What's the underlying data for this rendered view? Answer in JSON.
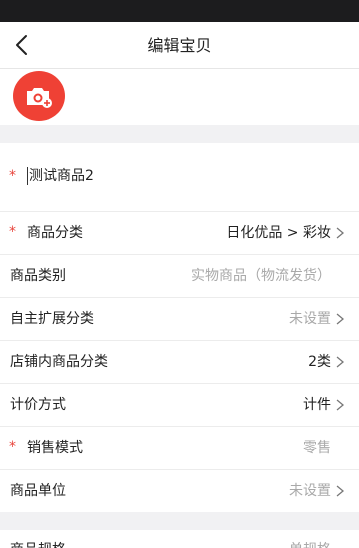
{
  "nav": {
    "title": "编辑宝贝",
    "back_icon": "chevron-left-icon"
  },
  "photo": {
    "add_icon": "camera-add-icon",
    "accent": "#ef4135"
  },
  "name_field": {
    "required_mark": "*",
    "value": "测试商品2"
  },
  "rows": [
    {
      "required": true,
      "label": "商品分类",
      "value": "日化优品 > 彩妆",
      "value_style": "dark",
      "chevron": true
    },
    {
      "required": false,
      "label": "商品类别",
      "value": "实物商品（物流发货）",
      "value_style": "gray",
      "chevron": false
    },
    {
      "required": false,
      "label": "自主扩展分类",
      "value": "未设置",
      "value_style": "gray",
      "chevron": true
    },
    {
      "required": false,
      "label": "店铺内商品分类",
      "value": "2类",
      "value_style": "dark",
      "chevron": true
    },
    {
      "required": false,
      "label": "计价方式",
      "value": "计件",
      "value_style": "dark",
      "chevron": true
    },
    {
      "required": true,
      "label": "销售模式",
      "value": "零售",
      "value_style": "gray",
      "chevron": false
    },
    {
      "required": false,
      "label": "商品单位",
      "value": "未设置",
      "value_style": "gray",
      "chevron": true
    }
  ],
  "partial_row": {
    "label": "商品规格",
    "value": "单规格"
  },
  "colors": {
    "required": "#e8453c",
    "background": "#f1f1f3",
    "status_bar": "#1c1c1e"
  }
}
